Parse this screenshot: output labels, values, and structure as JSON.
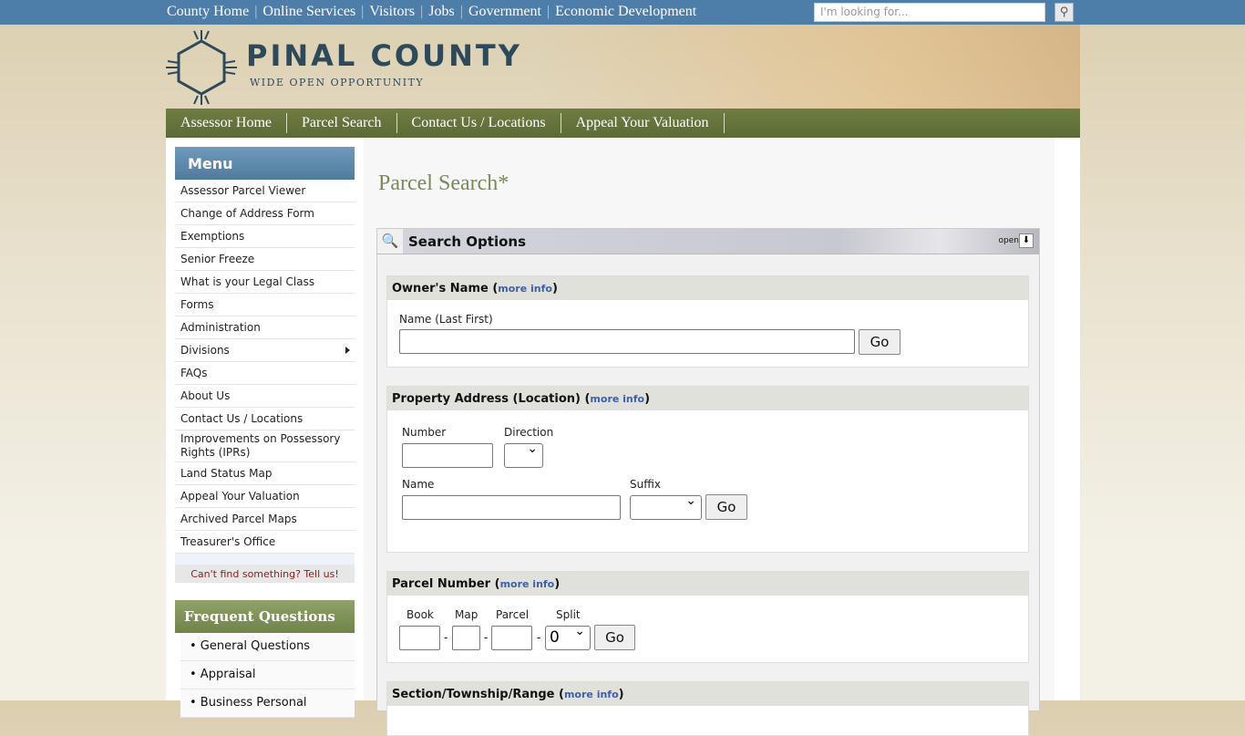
{
  "topbar": {
    "links": [
      "County Home",
      "Online Services",
      "Visitors",
      "Jobs",
      "Government",
      "Economic Development"
    ],
    "search_placeholder": "I'm looking for..."
  },
  "header": {
    "brand": "PINAL COUNTY",
    "tagline": "WIDE OPEN OPPORTUNITY"
  },
  "nav": [
    "Assessor Home",
    "Parcel Search",
    "Contact Us / Locations",
    "Appeal Your Valuation"
  ],
  "sidebar": {
    "menu_title": "Menu",
    "items": [
      "Assessor Parcel Viewer",
      "Change of Address Form",
      "Exemptions",
      "Senior Freeze",
      "What is your Legal Class",
      "Forms",
      "Administration",
      "Divisions",
      "FAQs",
      "About Us",
      "Contact Us / Locations",
      "Improvements on Possessory Rights (IPRs)",
      "Land Status Map",
      "Appeal Your Valuation",
      "Archived Parcel Maps",
      "Treasurer's Office"
    ],
    "cant_find": "Can't find something? Tell us!",
    "faq_title": "Frequent Questions",
    "faq_items": [
      "• General Questions",
      "• Appraisal",
      "• Business Personal"
    ]
  },
  "main": {
    "title": "Parcel Search*",
    "panel_title": "Search Options",
    "panel_toggle": "open",
    "more_info": "more info",
    "owner": {
      "title": "Owner's Name",
      "label": "Name (Last First)",
      "go": "Go"
    },
    "address": {
      "title": "Property Address (Location)",
      "number": "Number",
      "direction": "Direction",
      "name": "Name",
      "suffix": "Suffix",
      "go": "Go"
    },
    "parcel": {
      "title": "Parcel Number",
      "book": "Book",
      "map": "Map",
      "parcel": "Parcel",
      "split": "Split",
      "split_value": "0",
      "dash": "-",
      "go": "Go"
    },
    "str": {
      "title": "Section/Township/Range"
    }
  }
}
